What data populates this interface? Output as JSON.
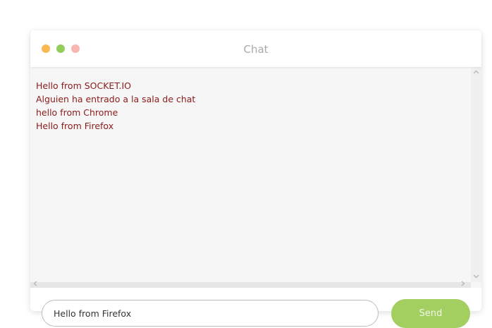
{
  "window": {
    "title": "Chat",
    "controls": [
      {
        "name": "minimize",
        "color": "#fbb954"
      },
      {
        "name": "maximize",
        "color": "#93cd5c"
      },
      {
        "name": "close",
        "color": "#f7b7b0"
      }
    ]
  },
  "messages": [
    "Hello from SOCKET.IO",
    "Alguien ha entrado a la sala de chat",
    "hello from Chrome",
    "Hello from Firefox"
  ],
  "scrollbar": {
    "up_icon": "▲",
    "down_icon": "▼",
    "left_icon": "◀",
    "right_icon": "▶"
  },
  "composer": {
    "input_value": "Hello from Firefox",
    "send_label": "Send"
  },
  "colors": {
    "message_text": "#8b1a1a",
    "send_button": "#a2cf5f"
  }
}
